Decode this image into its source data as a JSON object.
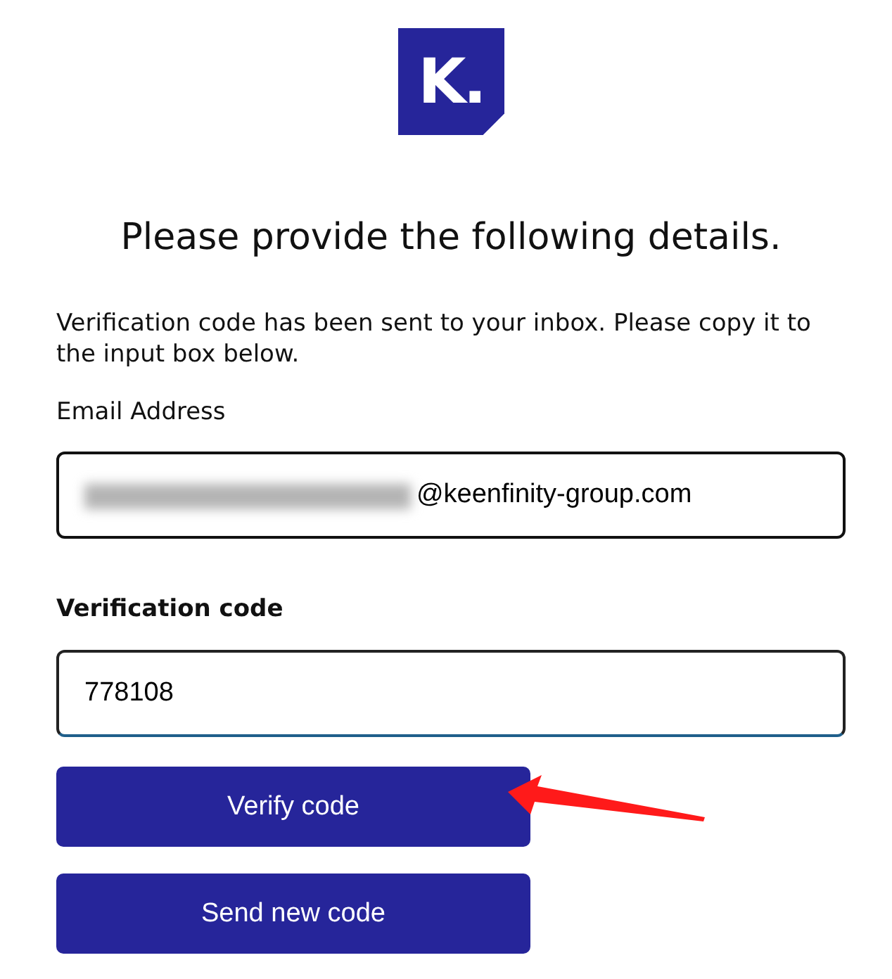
{
  "logo": {
    "text": "K."
  },
  "heading": "Please provide the following details.",
  "intro": "Verification code has been sent to your inbox. Please copy it to the input box below.",
  "email": {
    "label": "Email Address",
    "value": "@keenfinity-group.com",
    "redacted_prefix": true
  },
  "code": {
    "label": "Verification code",
    "value": "778108"
  },
  "buttons": [
    {
      "label": "Verify code",
      "pointed_at": true
    },
    {
      "label": "Send new code",
      "pointed_at": false
    }
  ]
}
